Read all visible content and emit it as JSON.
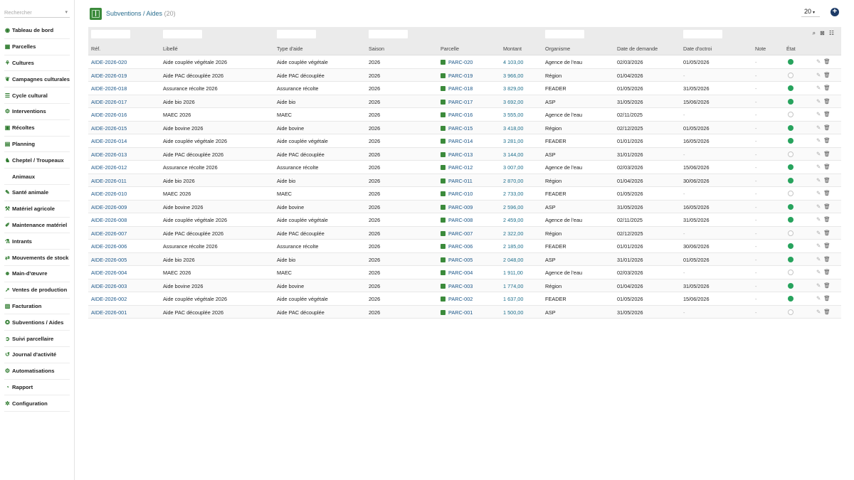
{
  "search": {
    "placeholder": "Rechercher"
  },
  "sidebar": {
    "items": [
      {
        "label": "Tableau de bord",
        "icon": "dashboard-icon",
        "glyph": "◉"
      },
      {
        "label": "Parcelles",
        "icon": "field-icon",
        "glyph": "▦"
      },
      {
        "label": "Cultures",
        "icon": "sprout-icon",
        "glyph": "⚘"
      },
      {
        "label": "Campagnes culturales",
        "icon": "leaf-icon",
        "glyph": "❦"
      },
      {
        "label": "Cycle cultural",
        "icon": "list-icon",
        "glyph": "☰"
      },
      {
        "label": "Interventions",
        "icon": "tractor-icon",
        "glyph": "⚙"
      },
      {
        "label": "Récoltes",
        "icon": "harvest-icon",
        "glyph": "▣"
      },
      {
        "label": "Planning",
        "icon": "calendar-icon",
        "glyph": "▤"
      },
      {
        "label": "Cheptel / Troupeaux",
        "icon": "cow-icon",
        "glyph": "♞"
      },
      {
        "label": "Animaux",
        "icon": "",
        "glyph": ""
      },
      {
        "label": "Santé animale",
        "icon": "syringe-icon",
        "glyph": "✎"
      },
      {
        "label": "Matériel agricole",
        "icon": "machine-icon",
        "glyph": "⚒"
      },
      {
        "label": "Maintenance matériel",
        "icon": "wrench-icon",
        "glyph": "✐"
      },
      {
        "label": "Intrants",
        "icon": "flask-icon",
        "glyph": "⚗"
      },
      {
        "label": "Mouvements de stock",
        "icon": "exchange-icon",
        "glyph": "⇄"
      },
      {
        "label": "Main-d'œuvre",
        "icon": "user-icon",
        "glyph": "☻"
      },
      {
        "label": "Ventes de production",
        "icon": "sales-icon",
        "glyph": "➚"
      },
      {
        "label": "Facturation",
        "icon": "invoice-icon",
        "glyph": "▥"
      },
      {
        "label": "Subventions / Aides",
        "icon": "award-icon",
        "glyph": "✪"
      },
      {
        "label": "Suivi parcellaire",
        "icon": "tracking-icon",
        "glyph": "➲"
      },
      {
        "label": "Journal d'activité",
        "icon": "history-icon",
        "glyph": "↺"
      },
      {
        "label": "Automatisations",
        "icon": "robot-icon",
        "glyph": "⚙"
      },
      {
        "label": "Rapport",
        "icon": "report-icon",
        "glyph": "◔"
      },
      {
        "label": "Configuration",
        "icon": "cog-icon",
        "glyph": "✲"
      }
    ]
  },
  "header": {
    "breadcrumb": "Subventions / Aides",
    "count": "(20)",
    "page_size": "20",
    "add_label": "+"
  },
  "table": {
    "columns": [
      "Réf.",
      "Libellé",
      "Type d'aide",
      "Saison",
      "Parcelle",
      "Montant",
      "Organisme",
      "Date de demande",
      "Date d'octroi",
      "Note",
      "État"
    ],
    "rows": [
      [
        "AIDE-2026-020",
        "Aide couplée végétale 2026",
        "Aide couplée végétale",
        "2026",
        "PARC-020",
        "4 103,00",
        "Agence de l'eau",
        "02/03/2026",
        "01/05/2026",
        "-",
        "on"
      ],
      [
        "AIDE-2026-019",
        "Aide PAC découplée 2026",
        "Aide PAC découplée",
        "2026",
        "PARC-019",
        "3 966,00",
        "Région",
        "01/04/2026",
        "-",
        "-",
        "off"
      ],
      [
        "AIDE-2026-018",
        "Assurance récolte 2026",
        "Assurance récolte",
        "2026",
        "PARC-018",
        "3 829,00",
        "FEADER",
        "01/05/2026",
        "31/05/2026",
        "-",
        "on"
      ],
      [
        "AIDE-2026-017",
        "Aide bio 2026",
        "Aide bio",
        "2026",
        "PARC-017",
        "3 692,00",
        "ASP",
        "31/05/2026",
        "15/06/2026",
        "-",
        "on"
      ],
      [
        "AIDE-2026-016",
        "MAEC 2026",
        "MAEC",
        "2026",
        "PARC-016",
        "3 555,00",
        "Agence de l'eau",
        "02/11/2025",
        "-",
        "-",
        "off"
      ],
      [
        "AIDE-2026-015",
        "Aide bovine 2026",
        "Aide bovine",
        "2026",
        "PARC-015",
        "3 418,00",
        "Région",
        "02/12/2025",
        "01/05/2026",
        "-",
        "on"
      ],
      [
        "AIDE-2026-014",
        "Aide couplée végétale 2026",
        "Aide couplée végétale",
        "2026",
        "PARC-014",
        "3 281,00",
        "FEADER",
        "01/01/2026",
        "16/05/2026",
        "-",
        "on"
      ],
      [
        "AIDE-2026-013",
        "Aide PAC découplée 2026",
        "Aide PAC découplée",
        "2026",
        "PARC-013",
        "3 144,00",
        "ASP",
        "31/01/2026",
        "-",
        "-",
        "off"
      ],
      [
        "AIDE-2026-012",
        "Assurance récolte 2026",
        "Assurance récolte",
        "2026",
        "PARC-012",
        "3 007,00",
        "Agence de l'eau",
        "02/03/2026",
        "15/06/2026",
        "-",
        "on"
      ],
      [
        "AIDE-2026-011",
        "Aide bio 2026",
        "Aide bio",
        "2026",
        "PARC-011",
        "2 870,00",
        "Région",
        "01/04/2026",
        "30/06/2026",
        "-",
        "on"
      ],
      [
        "AIDE-2026-010",
        "MAEC 2026",
        "MAEC",
        "2026",
        "PARC-010",
        "2 733,00",
        "FEADER",
        "01/05/2026",
        "-",
        "-",
        "off"
      ],
      [
        "AIDE-2026-009",
        "Aide bovine 2026",
        "Aide bovine",
        "2026",
        "PARC-009",
        "2 596,00",
        "ASP",
        "31/05/2026",
        "16/05/2026",
        "-",
        "on"
      ],
      [
        "AIDE-2026-008",
        "Aide couplée végétale 2026",
        "Aide couplée végétale",
        "2026",
        "PARC-008",
        "2 459,00",
        "Agence de l'eau",
        "02/11/2025",
        "31/05/2026",
        "-",
        "on"
      ],
      [
        "AIDE-2026-007",
        "Aide PAC découplée 2026",
        "Aide PAC découplée",
        "2026",
        "PARC-007",
        "2 322,00",
        "Région",
        "02/12/2025",
        "-",
        "-",
        "off"
      ],
      [
        "AIDE-2026-006",
        "Assurance récolte 2026",
        "Assurance récolte",
        "2026",
        "PARC-006",
        "2 185,00",
        "FEADER",
        "01/01/2026",
        "30/06/2026",
        "-",
        "on"
      ],
      [
        "AIDE-2026-005",
        "Aide bio 2026",
        "Aide bio",
        "2026",
        "PARC-005",
        "2 048,00",
        "ASP",
        "31/01/2026",
        "01/05/2026",
        "-",
        "on"
      ],
      [
        "AIDE-2026-004",
        "MAEC 2026",
        "MAEC",
        "2026",
        "PARC-004",
        "1 911,00",
        "Agence de l'eau",
        "02/03/2026",
        "-",
        "-",
        "off"
      ],
      [
        "AIDE-2026-003",
        "Aide bovine 2026",
        "Aide bovine",
        "2026",
        "PARC-003",
        "1 774,00",
        "Région",
        "01/04/2026",
        "31/05/2026",
        "-",
        "on"
      ],
      [
        "AIDE-2026-002",
        "Aide couplée végétale 2026",
        "Aide couplée végétale",
        "2026",
        "PARC-002",
        "1 637,00",
        "FEADER",
        "01/05/2026",
        "15/06/2026",
        "-",
        "on"
      ],
      [
        "AIDE-2026-001",
        "Aide PAC découplée 2026",
        "Aide PAC découplée",
        "2026",
        "PARC-001",
        "1 500,00",
        "ASP",
        "31/05/2026",
        "-",
        "-",
        "off"
      ]
    ]
  },
  "colors": {
    "accent": "#3b8a3b",
    "link": "#1b5688",
    "status_on": "#27a35d",
    "add_button": "#1c3a66"
  }
}
